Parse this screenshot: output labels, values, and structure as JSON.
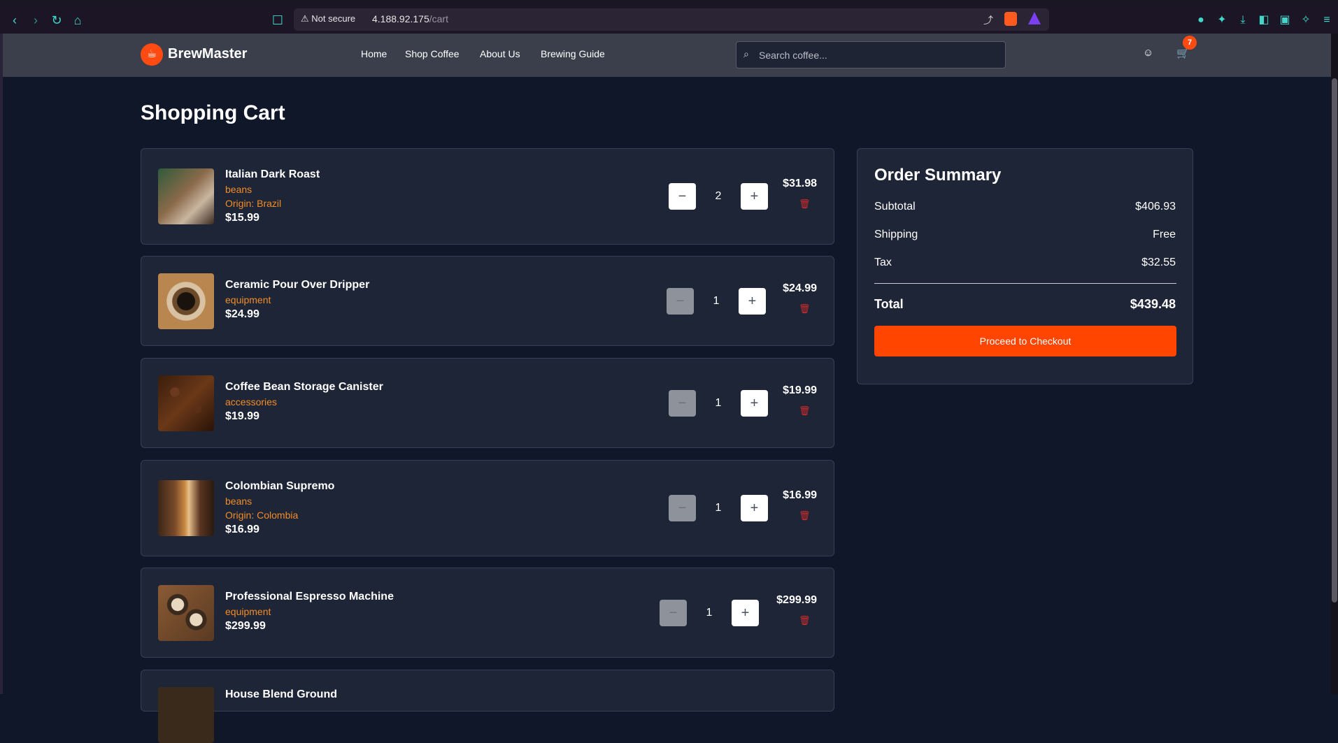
{
  "browser": {
    "security_label": "Not secure",
    "url_host": "4.188.92.175",
    "url_path": "/cart"
  },
  "header": {
    "brand": "BrewMaster",
    "nav": [
      "Home",
      "Shop Coffee",
      "About Us",
      "Brewing Guide"
    ],
    "search_placeholder": "Search coffee...",
    "cart_count": "7"
  },
  "page_title": "Shopping Cart",
  "cart_items": [
    {
      "name": "Italian Dark Roast",
      "category": "beans",
      "origin": "Origin: Brazil",
      "price": "$15.99",
      "quantity": "2",
      "line_total": "$31.98"
    },
    {
      "name": "Ceramic Pour Over Dripper",
      "category": "equipment",
      "price": "$24.99",
      "quantity": "1",
      "line_total": "$24.99"
    },
    {
      "name": "Coffee Bean Storage Canister",
      "category": "accessories",
      "price": "$19.99",
      "quantity": "1",
      "line_total": "$19.99"
    },
    {
      "name": "Colombian Supremo",
      "category": "beans",
      "origin": "Origin: Colombia",
      "price": "$16.99",
      "quantity": "1",
      "line_total": "$16.99"
    },
    {
      "name": "Professional Espresso Machine",
      "category": "equipment",
      "price": "$299.99",
      "quantity": "1",
      "line_total": "$299.99"
    },
    {
      "name": "House Blend Ground"
    }
  ],
  "summary": {
    "title": "Order Summary",
    "subtotal_label": "Subtotal",
    "subtotal": "$406.93",
    "shipping_label": "Shipping",
    "shipping": "Free",
    "tax_label": "Tax",
    "tax": "$32.55",
    "total_label": "Total",
    "total": "$439.48",
    "checkout_label": "Proceed to Checkout"
  },
  "colors": {
    "accent": "#ff4500",
    "category_text": "#f28c28",
    "trash": "#d42b2b"
  }
}
